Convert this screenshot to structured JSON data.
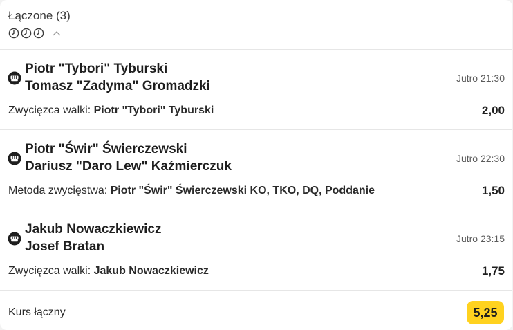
{
  "coupon": {
    "title": "Łączone (3)",
    "icons": [
      "clock-icon",
      "clock-icon",
      "clock-icon",
      "chevron-up-icon"
    ],
    "bets": [
      {
        "sport_icon": "mma-icon",
        "player1": "Piotr \"Tybori\" Tyburski",
        "player2": "Tomasz \"Zadyma\" Gromadzki",
        "time": "Jutro 21:30",
        "market": "Zwycięzca walki:",
        "pick": "Piotr \"Tybori\" Tyburski",
        "odds": "2,00"
      },
      {
        "sport_icon": "mma-icon",
        "player1": "Piotr \"Świr\" Świerczewski",
        "player2": "Dariusz \"Daro Lew\" Kaźmierczuk",
        "time": "Jutro 22:30",
        "market": "Metoda zwycięstwa:",
        "pick": "Piotr \"Świr\" Świerczewski KO, TKO, DQ, Poddanie",
        "odds": "1,50"
      },
      {
        "sport_icon": "mma-icon",
        "player1": "Jakub Nowaczkiewicz",
        "player2": "Josef Bratan",
        "time": "Jutro 23:15",
        "market": "Zwycięzca walki:",
        "pick": "Jakub Nowaczkiewicz",
        "odds": "1,75"
      }
    ],
    "total_label": "Kurs łączny",
    "total_odds": "5,25",
    "accent_color": "#ffd21f"
  }
}
